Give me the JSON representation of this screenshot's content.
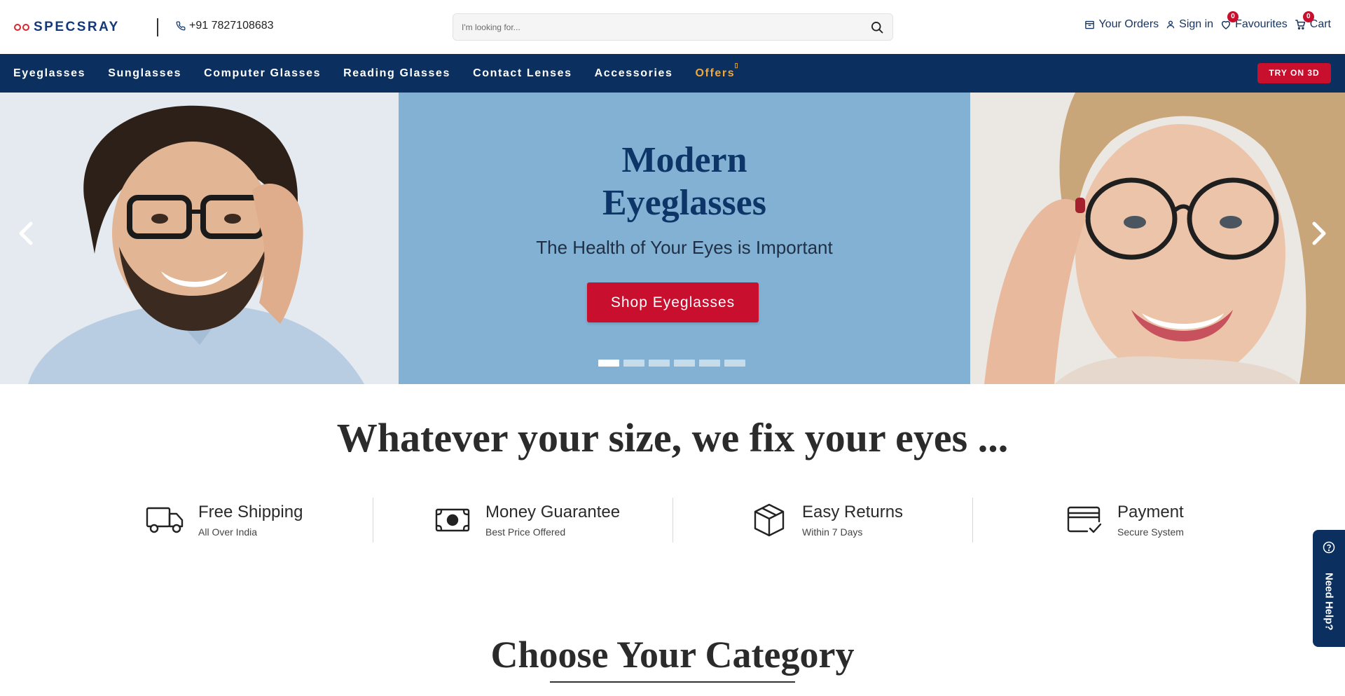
{
  "header": {
    "brand": "SPECSRAY",
    "phone": "+91 7827108683",
    "search_placeholder": "I'm looking for...",
    "links": {
      "orders": "Your Orders",
      "signin": "Sign in",
      "favourites": "Favourites",
      "favourites_count": "0",
      "cart": "Cart",
      "cart_count": "0"
    }
  },
  "nav": {
    "items": [
      {
        "label": "Eyeglasses"
      },
      {
        "label": "Sunglasses"
      },
      {
        "label": "Computer Glasses"
      },
      {
        "label": "Reading Glasses"
      },
      {
        "label": "Contact Lenses"
      },
      {
        "label": "Accessories"
      },
      {
        "label": "Offers"
      }
    ],
    "try_button": "TRY ON 3D"
  },
  "hero": {
    "title_line1": "Modern",
    "title_line2": "Eyeglasses",
    "subtitle": "The Health of Your Eyes is Important",
    "cta": "Shop Eyeglasses",
    "slide_count": 6,
    "active_slide": 1,
    "bg_color": "#83b1d3"
  },
  "tagline": "Whatever your size, we fix your eyes ...",
  "features": [
    {
      "icon": "truck-icon",
      "title": "Free Shipping",
      "subtitle": "All Over India"
    },
    {
      "icon": "money-icon",
      "title": "Money Guarantee",
      "subtitle": "Best Price Offered"
    },
    {
      "icon": "box-icon",
      "title": "Easy Returns",
      "subtitle": "Within 7 Days"
    },
    {
      "icon": "card-icon",
      "title": "Payment",
      "subtitle": "Secure System"
    }
  ],
  "help": {
    "label": "Need Help?"
  },
  "category": {
    "title": "Choose Your Category"
  },
  "colors": {
    "navy": "#0b2f5e",
    "accent_red": "#c8102e",
    "offer_orange": "#f0a93b"
  }
}
